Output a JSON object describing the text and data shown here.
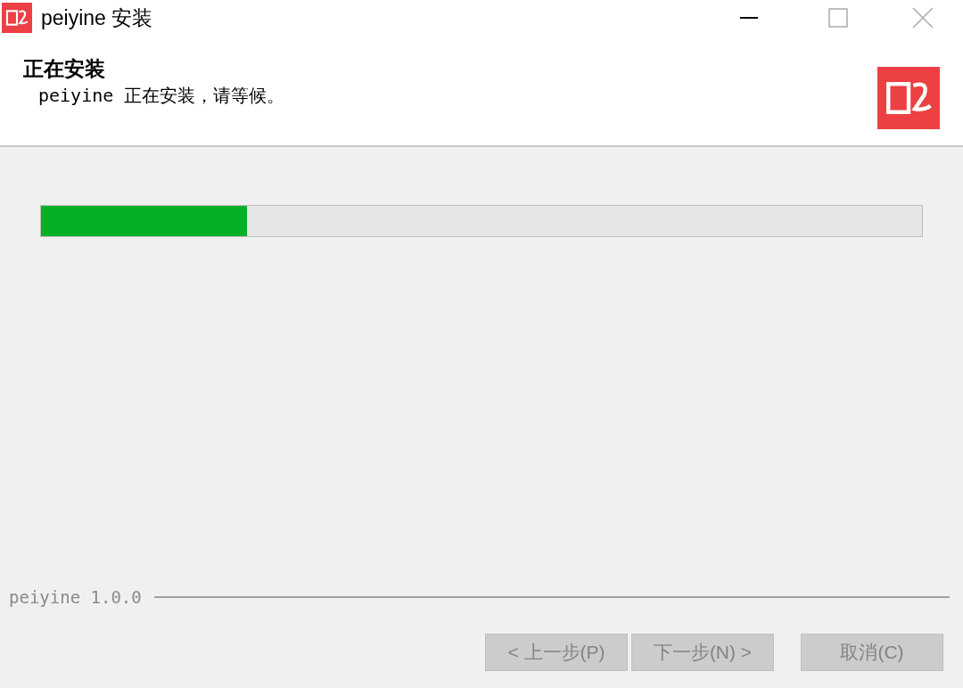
{
  "window": {
    "title": "peiyine 安装"
  },
  "header": {
    "title": "正在安装",
    "subtitle": "peiyine 正在安装，请等候。"
  },
  "progress": {
    "level": 0.234
  },
  "footer": {
    "brand": "peiyine 1.0.0"
  },
  "buttons": [
    {
      "label": "< 上一步(P)",
      "disabled": true
    },
    {
      "label": "下一步(N) >",
      "disabled": true
    },
    {
      "label": "取消(C)",
      "disabled": true
    }
  ]
}
